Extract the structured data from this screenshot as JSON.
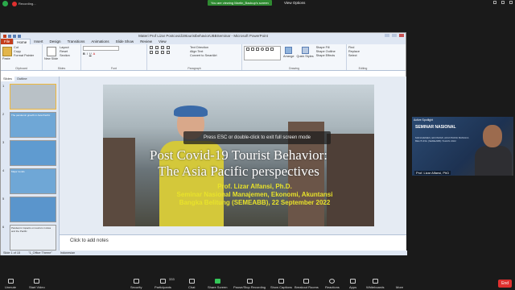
{
  "topbar": {
    "recording_label": "Recording...",
    "viewing_label": "You are viewing Martin_Backup's screen",
    "view_options": "View Options"
  },
  "powerpoint": {
    "title": "Materi Prof Lizar Postcovid19touristbehaviorUBBSeminar - Microsoft PowerPoint",
    "tabs": [
      "File",
      "Home",
      "Insert",
      "Design",
      "Transitions",
      "Animations",
      "Slide Show",
      "Review",
      "View"
    ],
    "groups": [
      "Clipboard",
      "Slides",
      "Font",
      "Paragraph",
      "Drawing",
      "Editing"
    ],
    "clipboard": {
      "paste": "Paste",
      "cut": "Cut",
      "copy": "Copy",
      "format_painter": "Format Painter"
    },
    "slides": {
      "new_slide": "New Slide",
      "layout": "Layout",
      "reset": "Reset",
      "section": "Section"
    },
    "paragraph": {
      "text_direction": "Text Direction",
      "align_text": "Align Text",
      "smartart": "Convert to SmartArt"
    },
    "drawing": {
      "arrange": "Arrange",
      "quick_styles": "Quick Styles",
      "shape_fill": "Shape Fill",
      "shape_outline": "Shape Outline",
      "shape_effects": "Shape Effects"
    },
    "editing": {
      "find": "Find",
      "replace": "Replace",
      "select": "Select"
    },
    "pane_tabs": [
      "Slides",
      "Outline"
    ],
    "thumbnails": [
      {
        "num": "1",
        "text": ""
      },
      {
        "num": "2",
        "text": "The pandemic growth in Asia Pacific"
      },
      {
        "num": "3",
        "text": ""
      },
      {
        "num": "4",
        "text": "Major trends"
      },
      {
        "num": "5",
        "text": ""
      },
      {
        "num": "6",
        "text": "Pandemic impacts on tourism in Asia and the Pacific"
      },
      {
        "num": "7",
        "text": ""
      }
    ],
    "esc_message": "Press ESC or double-click to exit full screen mode",
    "slide_title_line1": "Post Covid-19 Tourist Behavior:",
    "slide_title_line2": "The Asia Pacific perspectives",
    "slide_author": "Prof. Lizar Alfansi, Ph.D.",
    "slide_event_line1": "Seminar Nasional Manajemen, Ekonomi, Akuntansi",
    "slide_event_line2": "Bangka Belitung (SEMEABB), 22 September 2022",
    "notes": "Click to add notes",
    "status": [
      "Slide 1 of 15",
      "\"1_Office Theme\"",
      "Indonesian"
    ]
  },
  "video": {
    "badge": "Active Spotlight",
    "banner_line1": "SEMINAR NASIONAL",
    "banner_line2": "MANAJEMEN, EKONOMI, AKUNTANSI BANGKA BELITUNG (SEMEABB) TAHUN 2022",
    "name": "Prof. Lizar Alfansi, PhD"
  },
  "toolbar": {
    "items": [
      "Unmute",
      "Start Video",
      "Security",
      "Participants",
      "Chat",
      "Share Screen",
      "Pause/Stop Recording",
      "Show Captions",
      "Breakout Rooms",
      "Reactions",
      "Apps",
      "Whiteboards",
      "More"
    ],
    "participants_count": "333",
    "end_label": "End"
  }
}
